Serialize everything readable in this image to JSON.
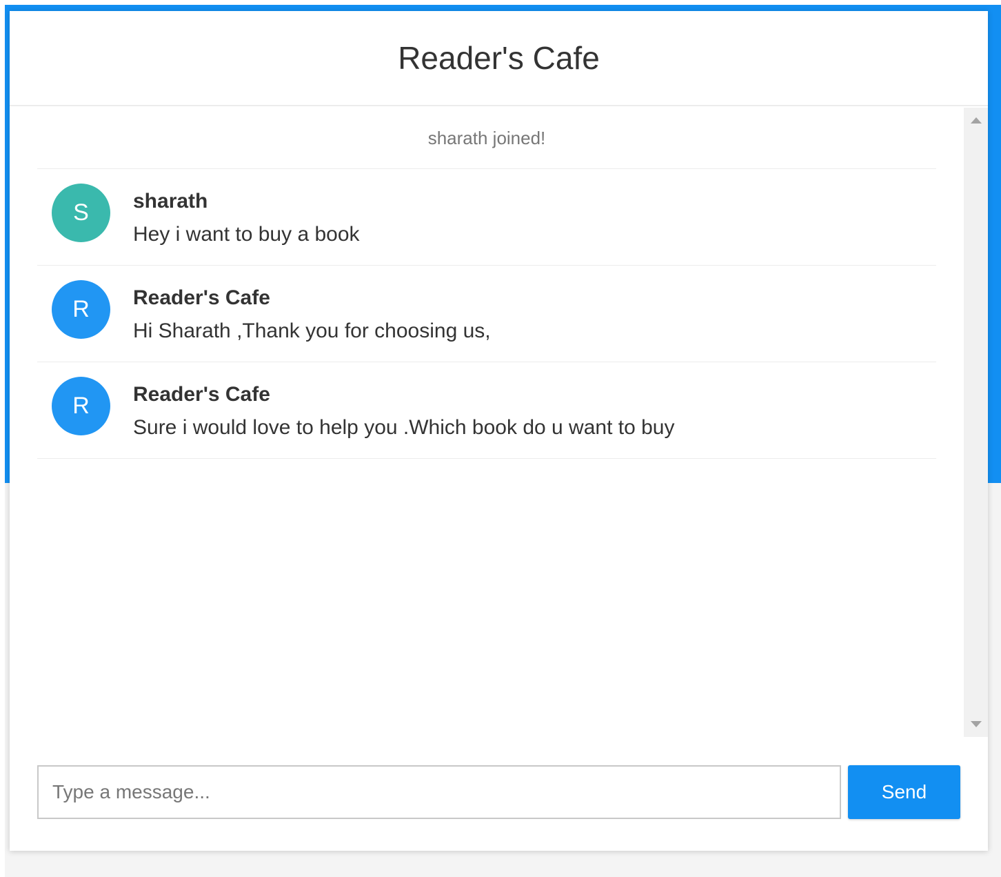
{
  "header": {
    "title": "Reader's Cafe"
  },
  "messages": {
    "event_text": "sharath joined!",
    "items": [
      {
        "avatar_letter": "S",
        "avatar_color": "#3ab9ad",
        "sender": "sharath",
        "text": "Hey i want to buy a book"
      },
      {
        "avatar_letter": "R",
        "avatar_color": "#2196f3",
        "sender": "Reader's Cafe",
        "text": "Hi Sharath ,Thank you for choosing us,"
      },
      {
        "avatar_letter": "R",
        "avatar_color": "#2196f3",
        "sender": "Reader's Cafe",
        "text": "Sure i would love to help you .Which book do u want to buy"
      }
    ]
  },
  "composer": {
    "placeholder": "Type a message...",
    "send_label": "Send"
  },
  "colors": {
    "accent": "#128ff2",
    "page_lower": "#f4f4f4"
  }
}
